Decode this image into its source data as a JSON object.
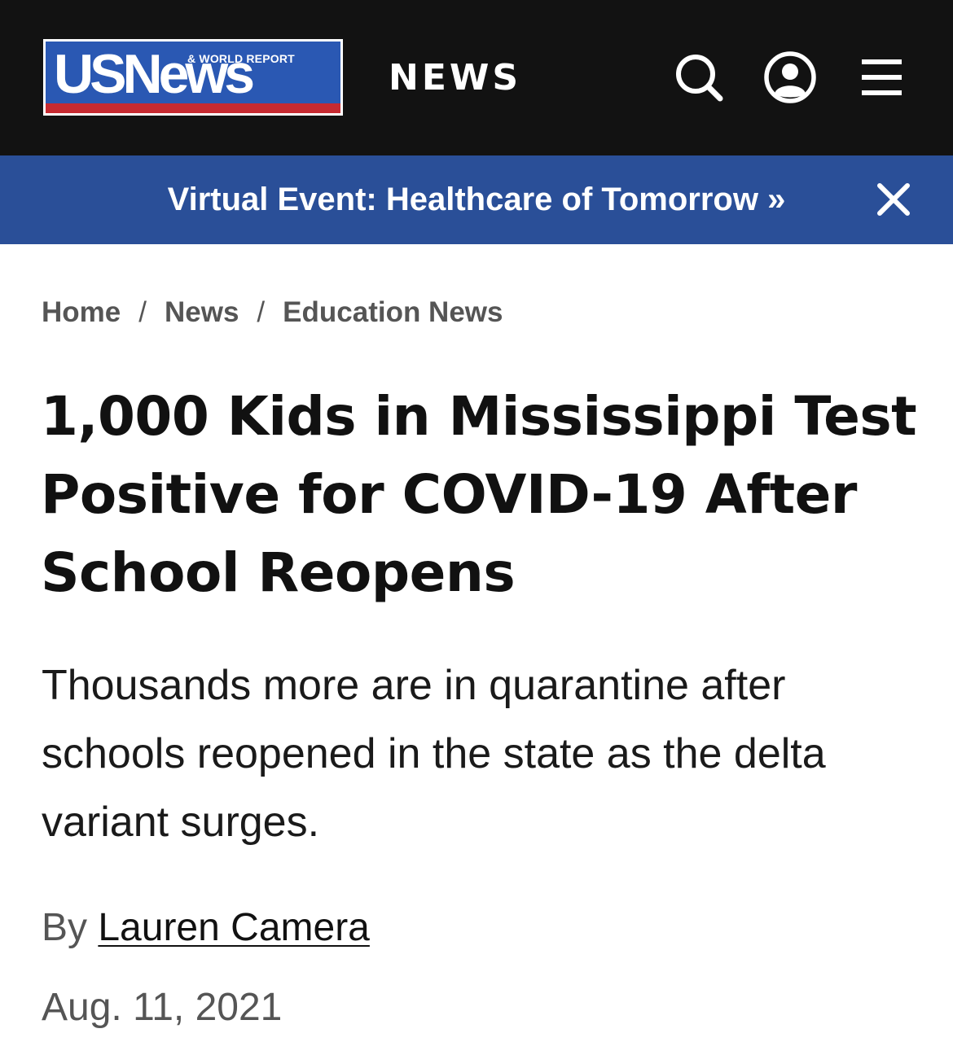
{
  "header": {
    "logo": {
      "main_text": "USNews",
      "sub_text": "& WORLD REPORT",
      "colors": {
        "blue": "#2a58b3",
        "red": "#c62a31"
      }
    },
    "section_label": "NEWS",
    "icons": [
      "search-icon",
      "account-icon",
      "menu-icon"
    ],
    "background": "#121212"
  },
  "banner": {
    "text": "Virtual Event: Healthcare of Tomorrow »",
    "close_icon": "close-icon",
    "background": "#2a4f98"
  },
  "breadcrumb": {
    "items": [
      "Home",
      "News",
      "Education News"
    ],
    "separator": "/"
  },
  "article": {
    "title": "1,000 Kids in Mississippi Test Positive for COVID-19 After School Reopens",
    "dek": "Thousands more are in quarantine after schools reopened in the state as the delta variant surges.",
    "byline_prefix": "By",
    "author": "Lauren Camera",
    "date": "Aug. 11, 2021"
  }
}
